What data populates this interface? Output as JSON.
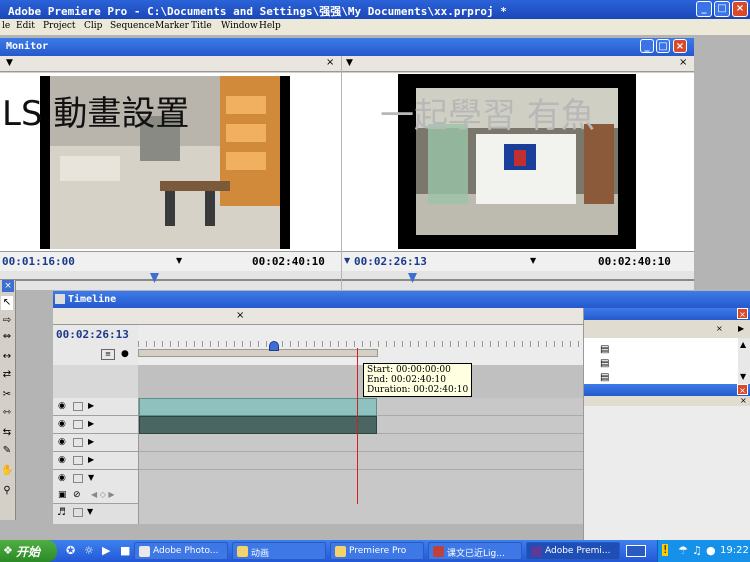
{
  "app": {
    "title": "Adobe Premiere Pro - C:\\Documents and Settings\\强强\\My Documents\\xx.prproj *",
    "min_icon": "minimize-icon",
    "max_icon": "maximize-icon",
    "close_icon": "close-icon"
  },
  "menu": [
    "le",
    "Edit",
    "Project",
    "Clip",
    "Sequence",
    "Marker",
    "Title",
    "Window",
    "Help"
  ],
  "monitor": {
    "title": "Monitor",
    "source": {
      "overlay_text": "LS 動畫設置",
      "timecode_current": "00:01:16:00",
      "timecode_duration": "00:02:40:10"
    },
    "program": {
      "overlay_text": "一起學習 有魚",
      "timecode_current": "00:02:26:13",
      "timecode_duration": "00:02:40:10"
    }
  },
  "timeline": {
    "title": "Timeline",
    "timecode": "00:02:26:13",
    "tooltip": {
      "start": "Start: 00:00:00:00",
      "end": "End: 00:02:40:10",
      "duration": "Duration: 00:02:40:10"
    }
  },
  "taskbar": {
    "start_label": "开始",
    "items": [
      "Adobe Photo...",
      "动画",
      "Premiere Pro",
      "课文已近Lig...",
      "Adobe Premi..."
    ],
    "clock": "19:22"
  },
  "colors": {
    "title_blue": "#2559cc",
    "video_clip": "#8fc2bf",
    "audio_clip": "#4a6663",
    "playhead": "#d02020",
    "taskbar": "#2358d6",
    "start_green": "#2c8a27"
  }
}
